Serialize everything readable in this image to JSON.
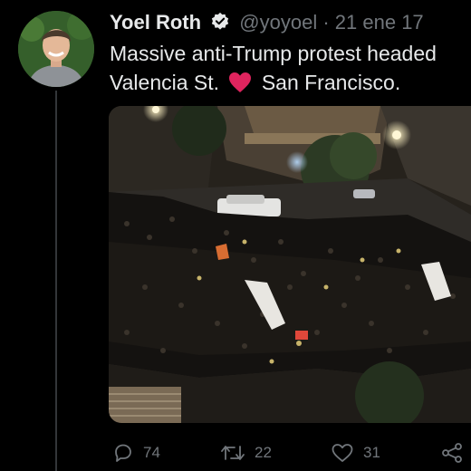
{
  "author": {
    "name": "Yoel Roth",
    "handle": "@yoyoel",
    "separator": "·",
    "date": "21 ene 17"
  },
  "tweet": {
    "line1": "Massive anti-Trump protest headed",
    "line2_before": "Valencia St.",
    "line2_after": "San Francisco."
  },
  "media": {
    "banner_left": "",
    "banner_right": ""
  },
  "actions": {
    "replies": "74",
    "retweets": "22",
    "likes": "31"
  },
  "icons": [
    "verified-badge-icon",
    "heart-emoji-icon",
    "reply-icon",
    "retweet-icon",
    "like-icon",
    "share-icon"
  ],
  "colors": {
    "background": "#000000",
    "text": "#e7e9ea",
    "muted": "#71767b",
    "heart": "#e0245e"
  }
}
